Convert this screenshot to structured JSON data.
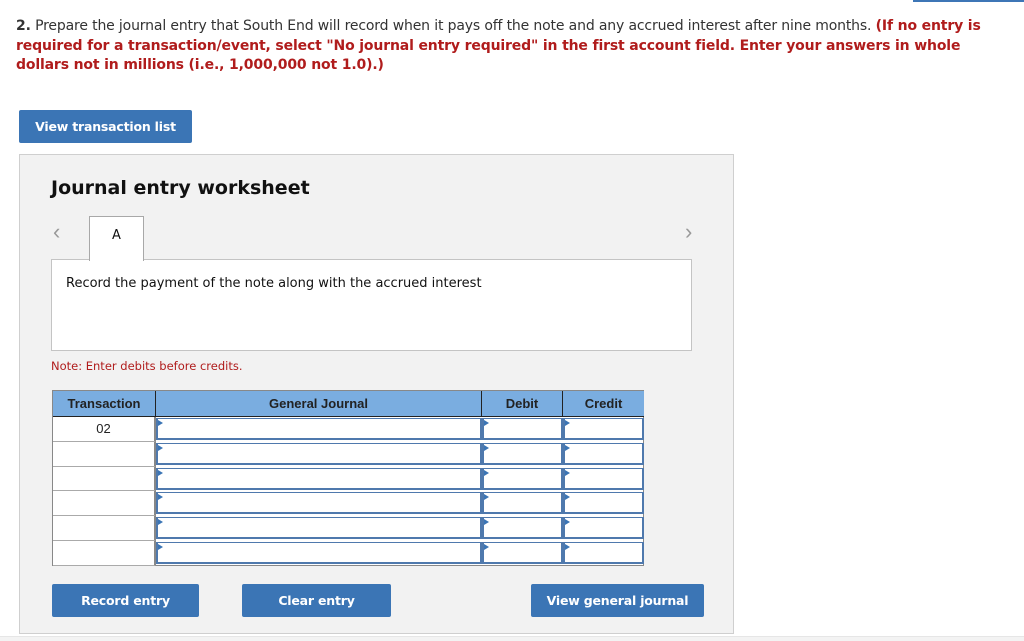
{
  "question": {
    "number": "2.",
    "text": " Prepare the journal entry that South End will record when it pays off the note and any accrued interest after nine months. ",
    "instruction": "(If no entry is required for a transaction/event, select \"No journal entry required\" in the first account field. Enter your answers in whole dollars not in millions (i.e., 1,000,000 not 1.0).)"
  },
  "buttons": {
    "view_transaction_list": "View transaction list",
    "record_entry": "Record entry",
    "clear_entry": "Clear entry",
    "view_general_journal": "View general journal"
  },
  "worksheet": {
    "title": "Journal entry worksheet",
    "prev_icon": "‹",
    "next_icon": "›",
    "tabs": [
      {
        "label": "A",
        "active": true
      }
    ],
    "description": "Record the payment of the note along with the accrued interest",
    "note": "Note: Enter debits before credits."
  },
  "table": {
    "headers": {
      "transaction": "Transaction",
      "general_journal": "General Journal",
      "debit": "Debit",
      "credit": "Credit"
    },
    "rows": [
      {
        "transaction": "02",
        "account": "",
        "debit": "",
        "credit": ""
      },
      {
        "transaction": "",
        "account": "",
        "debit": "",
        "credit": ""
      },
      {
        "transaction": "",
        "account": "",
        "debit": "",
        "credit": ""
      },
      {
        "transaction": "",
        "account": "",
        "debit": "",
        "credit": ""
      },
      {
        "transaction": "",
        "account": "",
        "debit": "",
        "credit": ""
      },
      {
        "transaction": "",
        "account": "",
        "debit": "",
        "credit": ""
      }
    ]
  },
  "colors": {
    "accent_blue": "#3b75b5",
    "header_blue": "#7aade0",
    "instruction_red": "#b01c1c",
    "panel_bg": "#f2f2f2"
  }
}
